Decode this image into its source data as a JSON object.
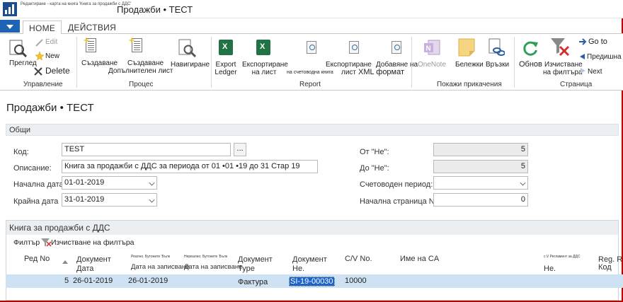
{
  "window": {
    "caption_small": "Редактиране - карта на книга 'Книга за продажби с ДДС'",
    "title": "Продажби • ТЕСТ"
  },
  "tabs": [
    {
      "label": "HOME",
      "active": true
    },
    {
      "label": "ДЕЙСТВИЯ",
      "active": false
    }
  ],
  "ribbon": {
    "manage": {
      "group_label": "Управление",
      "view": "Преглед",
      "edit": "Edit",
      "new": "New",
      "delete": "Delete"
    },
    "process": {
      "group_label": "Процес",
      "create1": "Създаване",
      "create2": "Създаване",
      "additional_sheet": "Допълнителен лист",
      "navigate": "Навигиране"
    },
    "report": {
      "group_label": "Report",
      "export_ledger_1": "Export",
      "export_ledger_2": "Ledger",
      "export_sheet_1": "Експортиране",
      "export_sheet_2": "на лист",
      "accounting_book": "на счетоводна книга",
      "export_sheet2_1": "Експортиране",
      "export_sheet2_2": "лист",
      "add_xml_1": "Добавяне на",
      "add_xml_2": "XML формат"
    },
    "attachments": {
      "group_label": "Покажи прикачения",
      "onenote": "OneNote",
      "notes": "Бележки",
      "links": "Връзки"
    },
    "page": {
      "group_label": "Страница",
      "refresh": "Обнов",
      "clear_filter_1": "Изчистване",
      "clear_filter_2": "на филтъра",
      "goto": "Go to",
      "previous": "Предишна",
      "next": "Next"
    }
  },
  "page_title": "Продажби • ТЕСТ",
  "general_section": {
    "title": "Общи",
    "code_label": "Код:",
    "code_value": "TEST",
    "lookup_button": "...",
    "description_label": "Описание:",
    "description_value": "Книга за продажби с ДДС за периода от 01 •01 •19 до 31 Стар 19",
    "start_date_label": "Начална дата",
    "start_date_value": "01-01-2019",
    "end_date_label": "Крайна дата",
    "end_date_value": "31-01-2019",
    "from_no_label": "От \"Не\":",
    "from_no_value": "5",
    "to_no_label": "До \"Не\":",
    "to_no_value": "5",
    "accounting_period_label": "Счетоводен период:",
    "accounting_period_value": "",
    "start_page_label": "Начална страница No.:",
    "start_page_value": "0"
  },
  "lines": {
    "title": "Книга за продажби с ДДС",
    "filter_label": "Филтър",
    "clear_filter_label": "Изчистване на филтъра",
    "headers": {
      "row_no": "Ред No",
      "doc_date_1": "Документ",
      "doc_date_2": "Дата",
      "posting_date_small": "Реално. Бутоните 'Бълк",
      "posting_date": "Дата на записване",
      "posting_date2_small": "Нереално. Бутоните 'Бълк",
      "posting_date2": "Дата на записване",
      "doc_type_1": "Документ",
      "doc_type_2": "Type",
      "doc_no_1": "Документ",
      "doc_no_2": "Не.",
      "cv_no": "C/V No.",
      "cv_name": "Име на CA",
      "cv_vat_small": "с.V Регламент за ДДС",
      "cv_vat": "Не.",
      "reg_1": "Reg. Re",
      "reg_2": "Код"
    },
    "rows": [
      {
        "row_no": "5",
        "doc_date": "26-01-2019",
        "posting_date": "26-01-2019",
        "posting_date2": "",
        "doc_type": "Фактура",
        "doc_no": "SI-19-00030",
        "cv_no": "10000",
        "cv_name": "",
        "cv_vat": "",
        "reg_code": ""
      }
    ]
  },
  "colors": {
    "accent": "#1f63b5",
    "frame": "#c00000",
    "row_highlight": "#cfe2f3",
    "selected_cell": "#1f63c7"
  }
}
